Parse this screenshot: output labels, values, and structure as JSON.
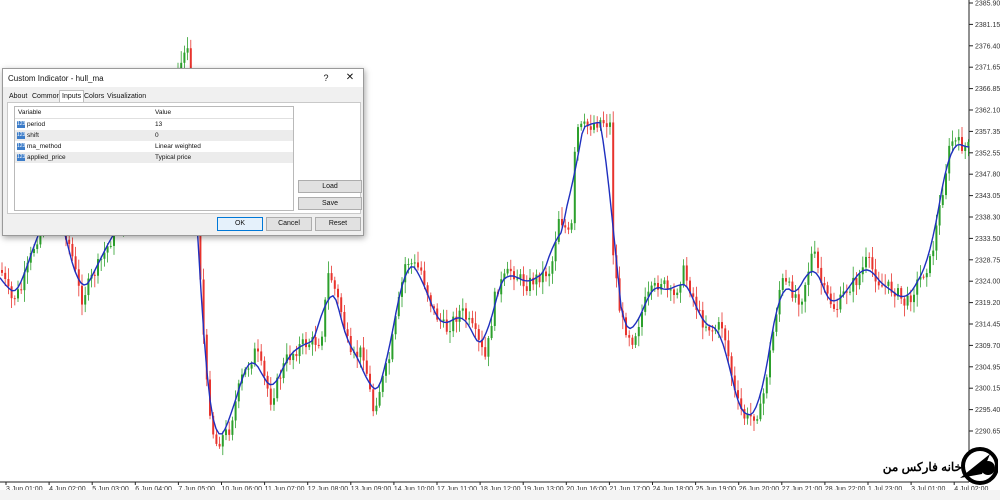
{
  "chart": {
    "price_labels": [
      "2385.90",
      "2381.15",
      "2376.40",
      "2371.65",
      "2366.85",
      "2362.10",
      "2357.35",
      "2352.55",
      "2347.80",
      "2343.05",
      "2338.30",
      "2333.50",
      "2328.75",
      "2324.00",
      "2319.20",
      "2314.45",
      "2309.70",
      "2304.95",
      "2300.15",
      "2295.40",
      "2290.65"
    ],
    "time_labels": [
      "3 Jun 01:00",
      "4 Jun 02:00",
      "5 Jun 03:00",
      "6 Jun 04:00",
      "7 Jun 05:00",
      "10 Jun 06:00",
      "11 Jun 07:00",
      "12 Jun 08:00",
      "13 Jun 09:00",
      "14 Jun 10:00",
      "17 Jun 11:00",
      "18 Jun 12:00",
      "19 Jun 13:00",
      "20 Jun 16:00",
      "21 Jun 17:00",
      "24 Jun 18:00",
      "25 Jun 19:00",
      "26 Jun 20:00",
      "27 Jun 21:00",
      "28 Jun 22:00",
      "1 Jul 23:00",
      "3 Jul 01:00",
      "4 Jul 02:00"
    ],
    "colors": {
      "bull": "#2ca02c",
      "bear": "#e8332d",
      "hull": "#1f2fbf"
    },
    "indicator_line_name": "hull_ma"
  },
  "dialog": {
    "title": "Custom Indicator - hull_ma",
    "help_label": "?",
    "close_label": "✕",
    "tabs": [
      "About",
      "Common",
      "Inputs",
      "Colors",
      "Visualization"
    ],
    "active_tab": "Inputs",
    "columns": {
      "variable": "Variable",
      "value": "Value"
    },
    "rows": [
      {
        "icon": "123",
        "variable": "period",
        "value": "13"
      },
      {
        "icon": "123",
        "variable": "shift",
        "value": "0"
      },
      {
        "icon": "123",
        "variable": "ma_method",
        "value": "Linear weighted"
      },
      {
        "icon": "123",
        "variable": "applied_price",
        "value": "Typical price"
      }
    ],
    "buttons": {
      "load": "Load",
      "save": "Save",
      "ok": "OK",
      "cancel": "Cancel",
      "reset": "Reset"
    }
  },
  "logo": {
    "text": "خانه فارکس من"
  }
}
